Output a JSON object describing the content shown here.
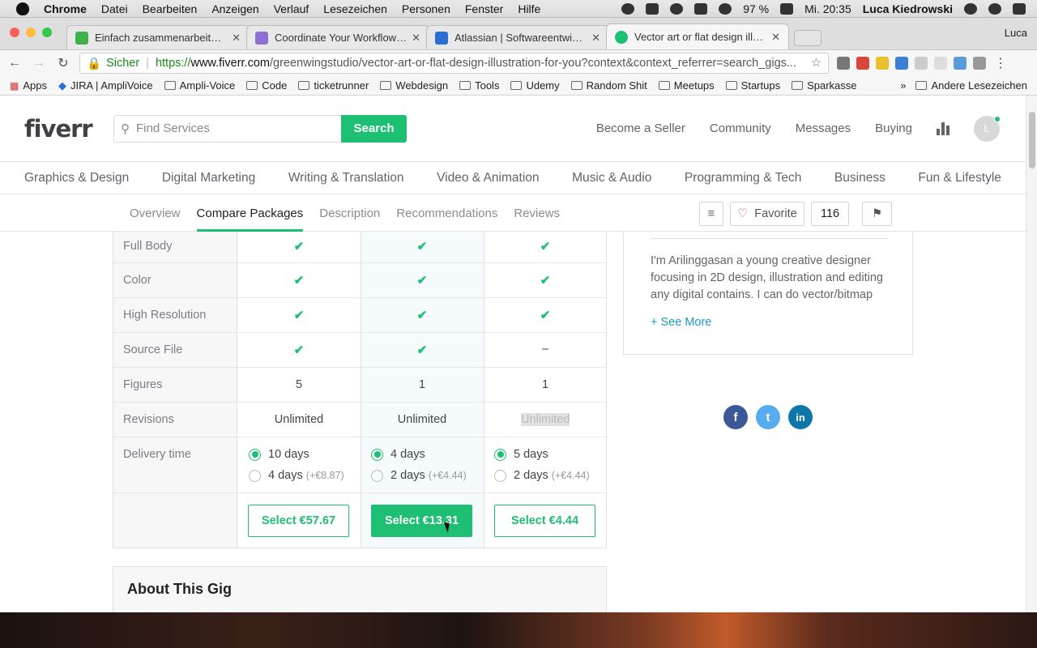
{
  "menubar": {
    "app": "Chrome",
    "items": [
      "Datei",
      "Bearbeiten",
      "Anzeigen",
      "Verlauf",
      "Lesezeichen",
      "Personen",
      "Fenster",
      "Hilfe"
    ],
    "battery": "97 %",
    "clock": "Mi. 20:35",
    "user": "Luca Kiedrowski"
  },
  "browser": {
    "tabs": [
      {
        "title": "Einfach zusammenarbeiten | S",
        "color": "#3fb04a"
      },
      {
        "title": "Coordinate Your Workflow Fro",
        "color": "#8d6fd4"
      },
      {
        "title": "Atlassian | Softwareentwicklun",
        "color": "#2a6fd4"
      },
      {
        "title": "Vector art or flat design illustra",
        "color": "#1dbf73"
      }
    ],
    "profile": "Luca",
    "secure_label": "Sicher",
    "url_scheme": "https://",
    "url_domain": "www.fiverr.com",
    "url_path": "/greenwingstudio/vector-art-or-flat-design-illustration-for-you?context&context_referrer=search_gigs...",
    "bookmarks": [
      "Apps",
      "JIRA | AmpliVoice",
      "Ampli-Voice",
      "Code",
      "ticketrunner",
      "Webdesign",
      "Tools",
      "Udemy",
      "Random Shit",
      "Meetups",
      "Startups",
      "Sparkasse"
    ],
    "bookmarks_overflow": "»",
    "other_bookmarks": "Andere Lesezeichen"
  },
  "header": {
    "logo": "fiverr",
    "search_placeholder": "Find Services",
    "search_button": "Search",
    "nav": [
      "Become a Seller",
      "Community",
      "Messages",
      "Buying"
    ],
    "avatar_letter": "L"
  },
  "categories": [
    "Graphics & Design",
    "Digital Marketing",
    "Writing & Translation",
    "Video & Animation",
    "Music & Audio",
    "Programming & Tech",
    "Business",
    "Fun & Lifestyle"
  ],
  "subnav": {
    "tabs": [
      "Overview",
      "Compare Packages",
      "Description",
      "Recommendations",
      "Reviews"
    ],
    "active": "Compare Packages",
    "favorite": "Favorite",
    "favorite_count": "116"
  },
  "compare": {
    "rows": [
      {
        "label": "Full Body",
        "values": [
          "✔",
          "✔",
          "✔"
        ]
      },
      {
        "label": "Color",
        "values": [
          "✔",
          "✔",
          "✔"
        ]
      },
      {
        "label": "High Resolution",
        "values": [
          "✔",
          "✔",
          "✔"
        ]
      },
      {
        "label": "Source File",
        "values": [
          "✔",
          "✔",
          "–"
        ]
      },
      {
        "label": "Figures",
        "values": [
          "5",
          "1",
          "1"
        ]
      },
      {
        "label": "Revisions",
        "values": [
          "Unlimited",
          "Unlimited",
          "Unlimited"
        ]
      }
    ],
    "delivery_label": "Delivery time",
    "delivery": [
      {
        "opt1": "10 days",
        "opt2": "4 days",
        "extra": "(+€8.87)"
      },
      {
        "opt1": "4 days",
        "opt2": "2 days",
        "extra": "(+€4.44)"
      },
      {
        "opt1": "5 days",
        "opt2": "2 days",
        "extra": "(+€4.44)"
      }
    ],
    "select_buttons": [
      "Select €57.67",
      "Select €13.31",
      "Select €4.44"
    ]
  },
  "about_title": "About This Gig",
  "seller": {
    "description": "I'm Arilinggasan a young creative designer focusing in 2D design, illustration and editing any digital contains. I can do vector/bitmap",
    "see_more": "+ See More"
  },
  "social": {
    "facebook": "f",
    "twitter": "t",
    "linkedin": "in"
  },
  "colors": {
    "brand": "#1dbf73",
    "link": "#1b9ac2",
    "facebook": "#3b5998",
    "twitter": "#55acee",
    "linkedin": "#0e76a8"
  }
}
